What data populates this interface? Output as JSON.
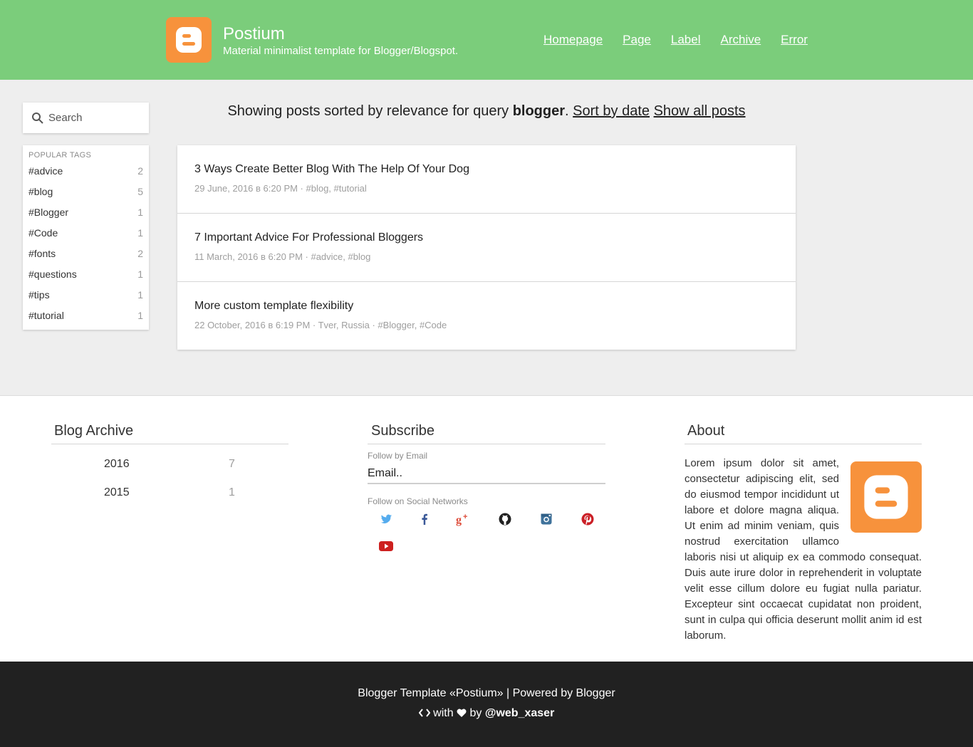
{
  "header": {
    "title": "Postium",
    "description": "Material minimalist template for Blogger/Blogspot.",
    "logo_icon": "blogger-logo-icon",
    "nav": [
      "Homepage",
      "Page",
      "Label",
      "Archive",
      "Error"
    ],
    "background": "#7bcd7b"
  },
  "search": {
    "placeholder": "Search",
    "icon": "search-icon"
  },
  "popular_tags": {
    "heading": "POPULAR TAGS",
    "tags": [
      {
        "name": "#advice",
        "count": "2"
      },
      {
        "name": "#blog",
        "count": "5"
      },
      {
        "name": "#Blogger",
        "count": "1"
      },
      {
        "name": "#Code",
        "count": "1"
      },
      {
        "name": "#fonts",
        "count": "2"
      },
      {
        "name": "#questions",
        "count": "1"
      },
      {
        "name": "#tips",
        "count": "1"
      },
      {
        "name": "#tutorial",
        "count": "1"
      }
    ]
  },
  "query": {
    "prefix": "Showing posts sorted by relevance for query ",
    "term": "blogger",
    "suffix": ". ",
    "sort_link": "Sort by date",
    "show_all_link": "Show all posts"
  },
  "posts": [
    {
      "title": "3 Ways Create Better Blog With The Help Of Your Dog",
      "meta": "29 June, 2016 в 6:20 PM · #blog, #tutorial"
    },
    {
      "title": "7 Important Advice For Professional Bloggers",
      "meta": "11 March, 2016 в 6:20 PM · #advice, #blog"
    },
    {
      "title": "More custom template flexibility",
      "meta": "22 October, 2016 в 6:19 PM · Tver, Russia · #Blogger, #Code"
    }
  ],
  "archive": {
    "title": "Blog Archive",
    "years": [
      {
        "year": "2016",
        "count": "7"
      },
      {
        "year": "2015",
        "count": "1"
      }
    ]
  },
  "subscribe": {
    "title": "Subscribe",
    "email_label": "Follow by Email",
    "email_placeholder": "Email..",
    "social_label": "Follow on Social Networks",
    "networks": [
      "twitter-icon",
      "facebook-icon",
      "google-plus-icon",
      "github-icon",
      "instagram-icon",
      "pinterest-icon",
      "youtube-icon"
    ]
  },
  "about": {
    "title": "About",
    "text": "Lorem ipsum dolor sit amet, consectetur adipiscing elit, sed do eiusmod tempor incididunt ut labore et dolore magna aliqua. Ut enim ad minim veniam, quis nostrud exercitation ullamco laboris nisi ut aliquip ex ea commodo consequat. Duis aute irure dolor in reprehenderit in voluptate velit esse cillum dolore eu fugiat nulla pariatur. Excepteur sint occaecat cupidatat non proident, sunt in culpa qui officia deserunt mollit anim id est laborum."
  },
  "footer": {
    "line1": "Blogger Template «Postium» | Powered by Blogger",
    "with_text": "with",
    "by_text": "by",
    "author": "@web_xaser",
    "background": "#212121"
  }
}
